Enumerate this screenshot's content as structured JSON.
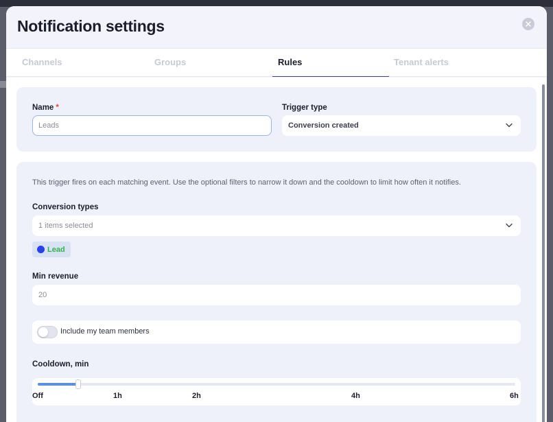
{
  "modal": {
    "title": "Notification settings"
  },
  "tabs": [
    {
      "label": "Channels",
      "active": false
    },
    {
      "label": "Groups",
      "active": false
    },
    {
      "label": "Rules",
      "active": true
    },
    {
      "label": "Tenant alerts",
      "active": false
    }
  ],
  "rule": {
    "name_label": "Name",
    "name_required": "*",
    "name_value": "Leads",
    "trigger_label": "Trigger type",
    "trigger_value": "Conversion created"
  },
  "filters": {
    "description": "This trigger fires on each matching event. Use the optional filters to narrow it down and the cooldown to limit how often it notifies.",
    "conversion_types_label": "Conversion types",
    "conversion_types_summary": "1 items selected",
    "selected_types": [
      {
        "label": "Lead",
        "dot_color": "#2b3ff0",
        "text_color": "#33b24a"
      }
    ],
    "min_revenue_label": "Min revenue",
    "min_revenue_value": "20",
    "team_toggle_label": "Include my team members",
    "team_toggle_on": false,
    "cooldown_label": "Cooldown, min",
    "cooldown_ticks": [
      "Off",
      "1h",
      "2h",
      "4h",
      "6h"
    ],
    "cooldown_fraction": 0.085
  },
  "colors": {
    "accent": "#5e8ee0",
    "required": "#e0483c",
    "tab_underline": "#3a3f8f"
  }
}
